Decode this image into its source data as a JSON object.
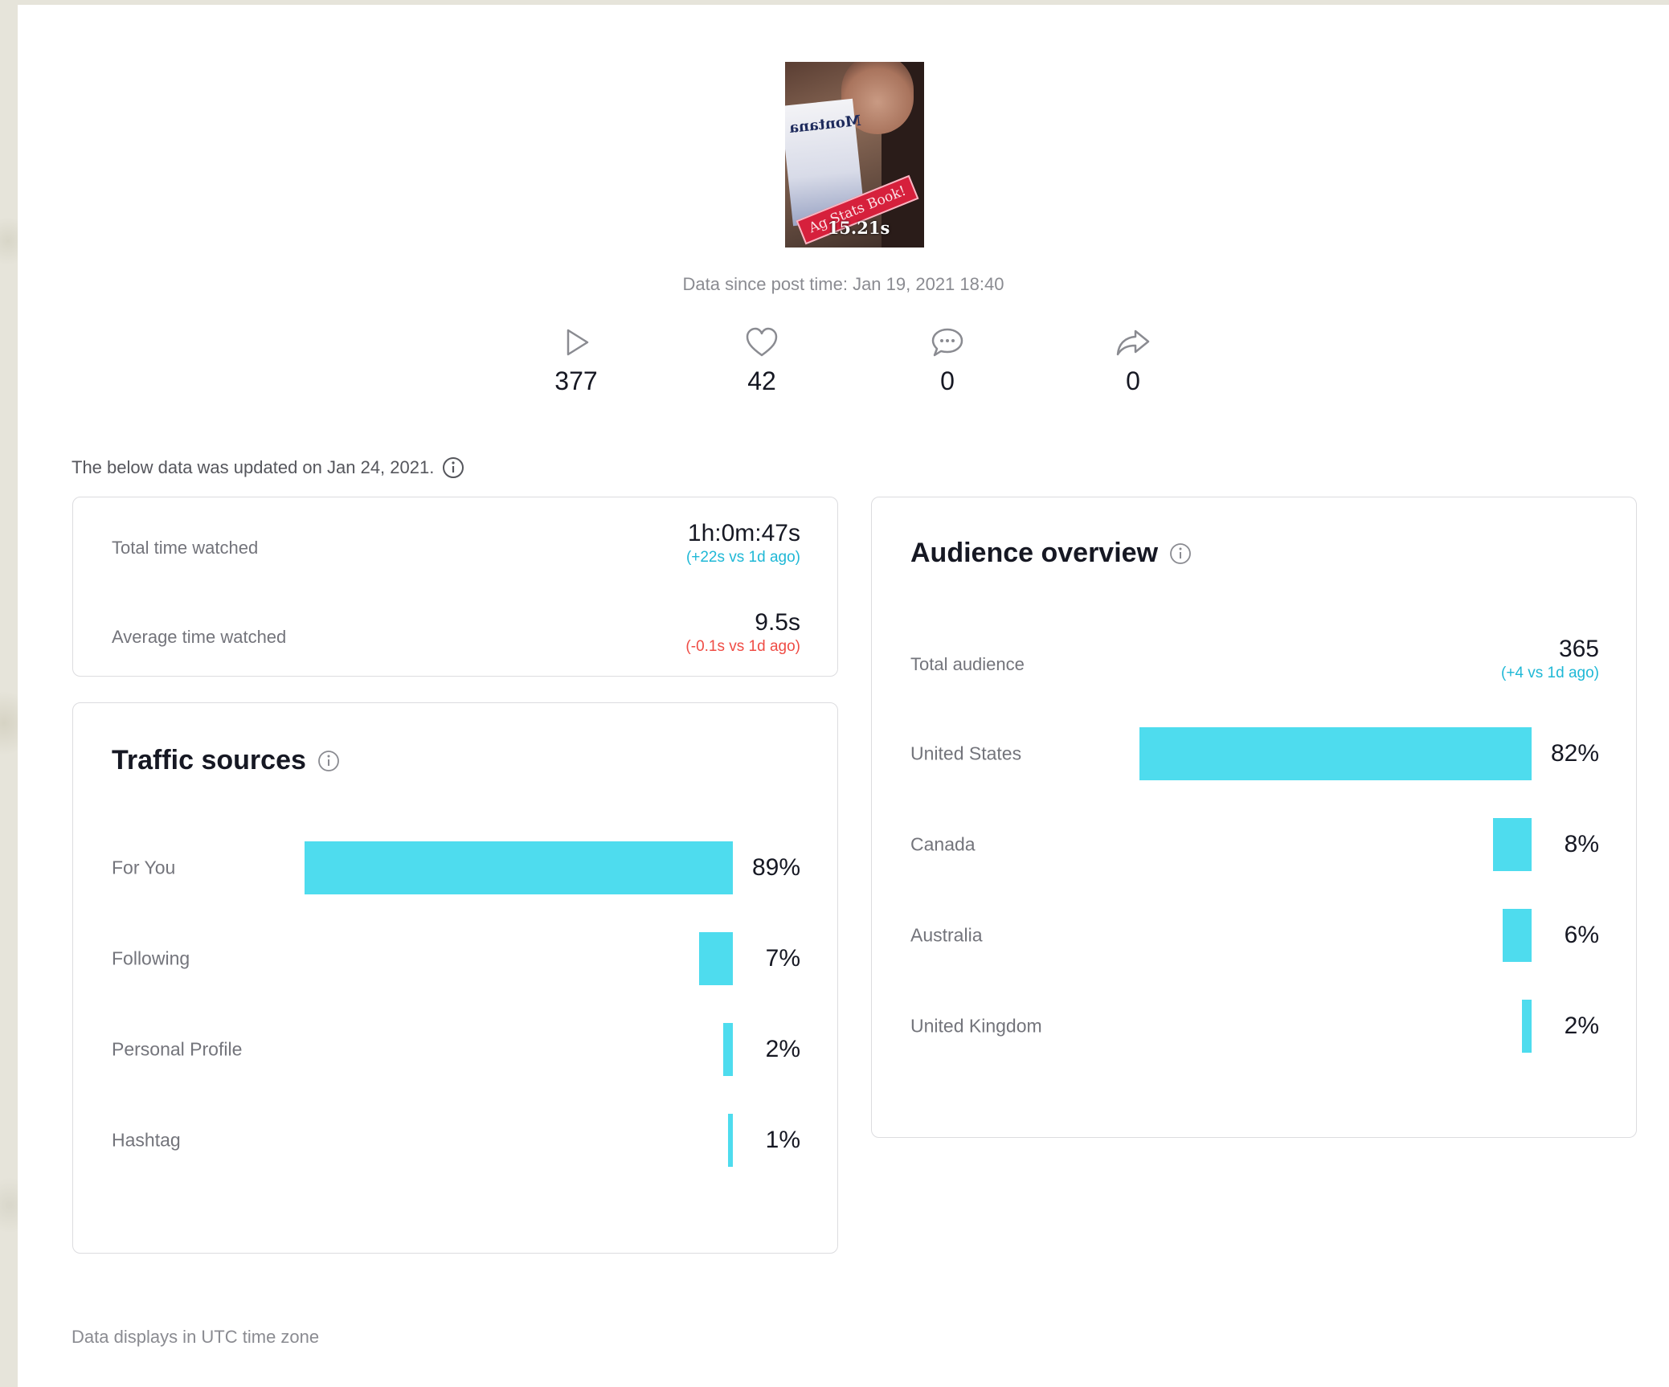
{
  "video": {
    "duration": "15.21s",
    "thumbnail_book_text": "Montana",
    "thumbnail_sticker": "Ag Stats Book!",
    "post_time_text": "Data since post time: Jan 19, 2021 18:40"
  },
  "stats": [
    {
      "icon": "play-icon",
      "value": "377"
    },
    {
      "icon": "heart-icon",
      "value": "42"
    },
    {
      "icon": "comment-icon",
      "value": "0"
    },
    {
      "icon": "share-icon",
      "value": "0"
    }
  ],
  "updated_text": "The below data was updated on Jan 24, 2021.",
  "watch_time": {
    "total_label": "Total time watched",
    "total_value": "1h:0m:47s",
    "total_delta": "(+22s vs 1d ago)",
    "average_label": "Average time watched",
    "average_value": "9.5s",
    "average_delta": "(-0.1s vs 1d ago)"
  },
  "traffic_sources": {
    "title": "Traffic sources",
    "rows": [
      {
        "label": "For You",
        "value": 89,
        "pct": "89%"
      },
      {
        "label": "Following",
        "value": 7,
        "pct": "7%"
      },
      {
        "label": "Personal Profile",
        "value": 2,
        "pct": "2%"
      },
      {
        "label": "Hashtag",
        "value": 1,
        "pct": "1%"
      }
    ]
  },
  "audience": {
    "title": "Audience overview",
    "total_label": "Total audience",
    "total_value": "365",
    "total_delta": "(+4 vs 1d ago)",
    "rows": [
      {
        "label": "United States",
        "value": 82,
        "pct": "82%"
      },
      {
        "label": "Canada",
        "value": 8,
        "pct": "8%"
      },
      {
        "label": "Australia",
        "value": 6,
        "pct": "6%"
      },
      {
        "label": "United Kingdom",
        "value": 2,
        "pct": "2%"
      }
    ]
  },
  "footer_note": "Data displays in UTC time zone",
  "colors": {
    "bar": "#4edcee",
    "delta_up": "#1fb8d6",
    "delta_down": "#ef4c45"
  }
}
